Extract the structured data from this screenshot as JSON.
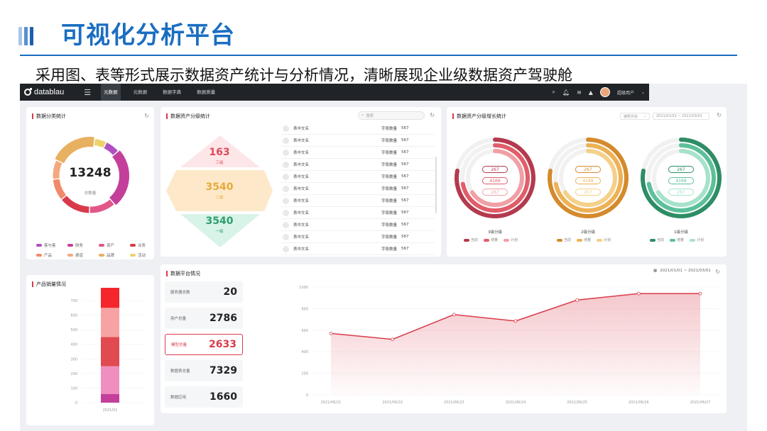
{
  "slide": {
    "title": "可视化分析平台",
    "subtitle": "采用图、表等形式展示数据资产统计与分析情况，清晰展现企业级数据资产驾驶舱"
  },
  "topbar": {
    "logo": "datablau",
    "tabs": [
      "元数据",
      "元数据",
      "数据字典",
      "数据质量"
    ],
    "active_tab": 0,
    "user": "超级用户",
    "icons": [
      "search-icon",
      "bell-icon",
      "layers-icon",
      "alert-icon"
    ]
  },
  "category": {
    "title": "数据分类统计",
    "total": "13248",
    "total_label": "总数量",
    "legend": [
      {
        "label": "客与客",
        "color": "#b04fc1"
      },
      {
        "label": "财务",
        "color": "#c43f9a"
      },
      {
        "label": "资产",
        "color": "#e2568a"
      },
      {
        "label": "业务",
        "color": "#d93b4a"
      },
      {
        "label": "产品",
        "color": "#f08a6a"
      },
      {
        "label": "渠道",
        "color": "#f3a880"
      },
      {
        "label": "品牌",
        "color": "#e8b061"
      },
      {
        "label": "活动",
        "color": "#ecd36b"
      }
    ],
    "ring_segments": [
      {
        "value": 6,
        "color": "#b04fc1"
      },
      {
        "value": 24,
        "color": "#c43f9a"
      },
      {
        "value": 11,
        "color": "#e2568a"
      },
      {
        "value": 13,
        "color": "#d93b4a"
      },
      {
        "value": 9,
        "color": "#f08a6a"
      },
      {
        "value": 8,
        "color": "#f3a880"
      },
      {
        "value": 19,
        "color": "#e8b061"
      },
      {
        "value": 5,
        "color": "#ecd36b"
      }
    ]
  },
  "grading": {
    "title": "数据资产分级统计",
    "search_placeholder": "搜索",
    "levels": [
      {
        "value": "163",
        "label": "三级",
        "color": "#e0495a",
        "bg": "#fde6e8"
      },
      {
        "value": "3540",
        "label": "二级",
        "color": "#e8a93b",
        "bg": "#fde9c9"
      },
      {
        "value": "3540",
        "label": "一级",
        "color": "#2e9e6e",
        "bg": "#d8f3e7"
      }
    ],
    "rows": [
      {
        "name": "表中文名",
        "field_label": "字段数量",
        "count": "567"
      },
      {
        "name": "表中文名",
        "field_label": "字段数量",
        "count": "567"
      },
      {
        "name": "表中文名",
        "field_label": "字段数量",
        "count": "567"
      },
      {
        "name": "表中文名",
        "field_label": "字段数量",
        "count": "567"
      },
      {
        "name": "表中文名",
        "field_label": "字段数量",
        "count": "567"
      },
      {
        "name": "表中文名",
        "field_label": "字段数量",
        "count": "567"
      },
      {
        "name": "表中文名",
        "field_label": "字段数量",
        "count": "567"
      },
      {
        "name": "表中文名",
        "field_label": "字段数量",
        "count": "567"
      },
      {
        "name": "表中文名",
        "field_label": "字段数量",
        "count": "567"
      },
      {
        "name": "表中文名",
        "field_label": "字段数量",
        "count": "567"
      },
      {
        "name": "表中文名",
        "field_label": "字段数量",
        "count": "567"
      }
    ]
  },
  "growth": {
    "title": "数据资产分级增长统计",
    "select": "按照月份",
    "date_range": "2021/01/01 ~ 2021/03/01",
    "groups": [
      {
        "caption": "3级分级",
        "pills": [
          "267",
          "4169",
          "267"
        ],
        "colors": [
          "#b43a4e",
          "#e15d69",
          "#f0a0a5"
        ],
        "legend": [
          "当前",
          "增量",
          "计划"
        ],
        "fills": [
          0.78,
          0.72,
          0.66
        ]
      },
      {
        "caption": "2级分级",
        "pills": [
          "267",
          "4169",
          "267"
        ],
        "colors": [
          "#d48a2c",
          "#eeb155",
          "#f5d08a"
        ],
        "legend": [
          "当前",
          "增量",
          "计划"
        ],
        "fills": [
          0.78,
          0.72,
          0.66
        ]
      },
      {
        "caption": "1级分级",
        "pills": [
          "267",
          "4169",
          "267"
        ],
        "colors": [
          "#2e8d65",
          "#5cc09a",
          "#a7e2cb"
        ],
        "legend": [
          "当前",
          "增量",
          "计划"
        ],
        "fills": [
          0.78,
          0.72,
          0.66
        ]
      }
    ]
  },
  "product": {
    "title": "产品销量情况",
    "chart_data": {
      "type": "bar",
      "categories": [
        "2021/01"
      ],
      "stack": [
        {
          "value": 60,
          "color": "#c43f9a"
        },
        {
          "value": 190,
          "color": "#f08fbf"
        },
        {
          "value": 200,
          "color": "#e04a50"
        },
        {
          "value": 200,
          "color": "#f7a3a3"
        },
        {
          "value": 270,
          "color": "#f5262b"
        }
      ],
      "yticks": [
        "0",
        "100",
        "200",
        "300",
        "400",
        "500",
        "600",
        "700"
      ],
      "ylim": [
        0,
        700
      ]
    }
  },
  "platform": {
    "title": "数据平台情况",
    "date_range": "2021/01/01 ~ 2021/03/01",
    "metrics": [
      {
        "label": "服务器总数",
        "value": "20",
        "active": false
      },
      {
        "label": "用户总量",
        "value": "2786",
        "active": false
      },
      {
        "label": "模型总量",
        "value": "2633",
        "active": true
      },
      {
        "label": "数据表总量",
        "value": "7329",
        "active": false
      },
      {
        "label": "数据应用",
        "value": "1660",
        "active": false
      }
    ],
    "chart_data": {
      "type": "area",
      "x": [
        "2021/06/21",
        "2021/06/22",
        "2021/06/23",
        "2021/06/24",
        "2021/06/25",
        "2021/06/26",
        "2021/06/27"
      ],
      "values": [
        570,
        515,
        745,
        685,
        880,
        940,
        940
      ],
      "yticks": [
        "0",
        "200",
        "400",
        "600",
        "800",
        "1000"
      ],
      "ylim": [
        0,
        1000
      ],
      "color": "#d93b4a"
    }
  }
}
